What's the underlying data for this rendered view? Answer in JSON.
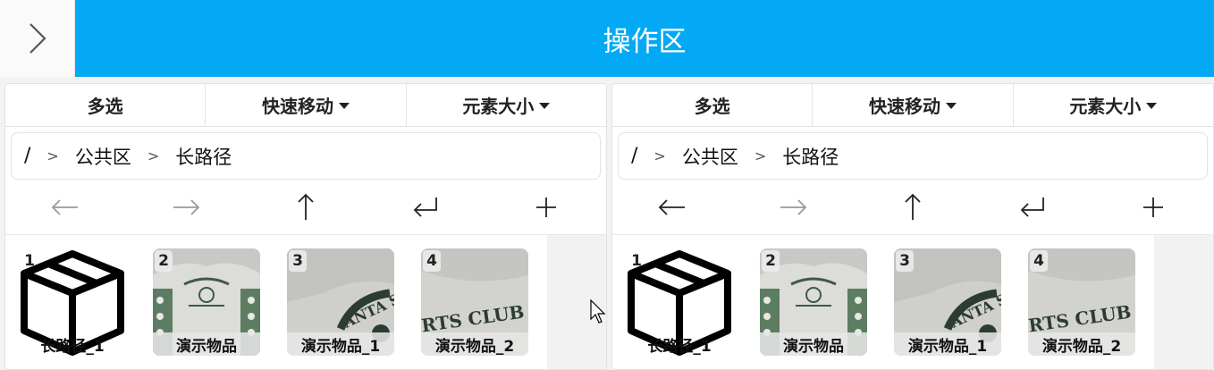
{
  "header": {
    "title": "操作区"
  },
  "colors": {
    "header_bg": "#03a9f4",
    "active_arrow": "#222222",
    "disabled_arrow": "#9a9a9a"
  },
  "panels": [
    {
      "menu": {
        "multi_select": "多选",
        "quick_move": "快速移动",
        "element_size": "元素大小"
      },
      "breadcrumb": {
        "root": "/",
        "sep": ">",
        "items": [
          "公共区",
          "长路径"
        ]
      },
      "nav": {
        "back_enabled": false,
        "forward_enabled": false
      },
      "tiles": [
        {
          "index": "1",
          "label": "长路径_1",
          "kind": "folder",
          "icon": "box-icon"
        },
        {
          "index": "2",
          "label": "演示物品",
          "kind": "photo"
        },
        {
          "index": "3",
          "label": "演示物品_1",
          "kind": "photo"
        },
        {
          "index": "4",
          "label": "演示物品_2",
          "kind": "photo"
        }
      ]
    },
    {
      "menu": {
        "multi_select": "多选",
        "quick_move": "快速移动",
        "element_size": "元素大小"
      },
      "breadcrumb": {
        "root": "/",
        "sep": ">",
        "items": [
          "公共区",
          "长路径"
        ]
      },
      "nav": {
        "back_enabled": true,
        "forward_enabled": false
      },
      "tiles": [
        {
          "index": "1",
          "label": "长路径_1",
          "kind": "folder",
          "icon": "box-icon"
        },
        {
          "index": "2",
          "label": "演示物品",
          "kind": "photo"
        },
        {
          "index": "3",
          "label": "演示物品_1",
          "kind": "photo"
        },
        {
          "index": "4",
          "label": "演示物品_2",
          "kind": "photo"
        }
      ]
    }
  ]
}
